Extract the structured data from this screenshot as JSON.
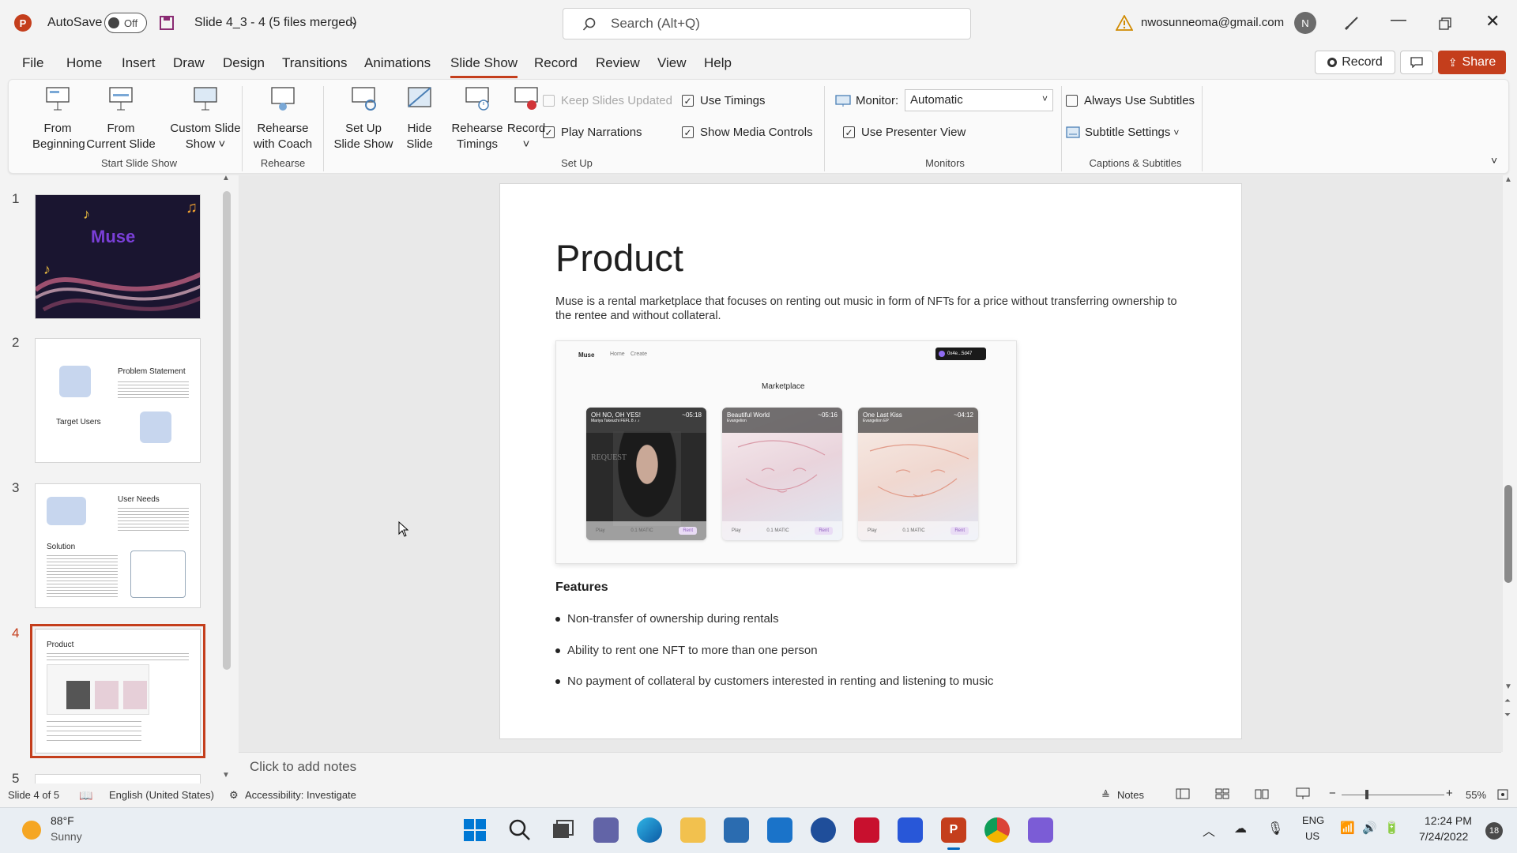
{
  "titlebar": {
    "autosave_label": "AutoSave",
    "autosave_state": "Off",
    "doc_title": "Slide 4_3 - 4 (5 files merged)",
    "search_placeholder": "Search (Alt+Q)",
    "account_email": "nwosunneoma@gmail.com",
    "avatar_initial": "N"
  },
  "menu": {
    "tabs": [
      "File",
      "Home",
      "Insert",
      "Draw",
      "Design",
      "Transitions",
      "Animations",
      "Slide Show",
      "Record",
      "Review",
      "View",
      "Help"
    ],
    "active_tab": "Slide Show",
    "record_button": "Record",
    "share_button": "Share"
  },
  "ribbon": {
    "start": {
      "from_beginning_1": "From",
      "from_beginning_2": "Beginning",
      "from_current_1": "From",
      "from_current_2": "Current Slide",
      "custom_1": "Custom Slide",
      "custom_2": "Show",
      "label": "Start Slide Show"
    },
    "rehearse": {
      "btn_1": "Rehearse",
      "btn_2": "with Coach",
      "label": "Rehearse"
    },
    "setup": {
      "setup_1": "Set Up",
      "setup_2": "Slide Show",
      "hide_1": "Hide",
      "hide_2": "Slide",
      "timings_1": "Rehearse",
      "timings_2": "Timings",
      "record": "Record",
      "keep_updated": "Keep Slides Updated",
      "play_narrations": "Play Narrations",
      "use_timings": "Use Timings",
      "show_media": "Show Media Controls",
      "label": "Set Up"
    },
    "monitors": {
      "monitor_label": "Monitor:",
      "monitor_value": "Automatic",
      "presenter_view": "Use Presenter View",
      "label": "Monitors"
    },
    "captions": {
      "always_subtitles": "Always Use Subtitles",
      "subtitle_settings": "Subtitle Settings",
      "label": "Captions & Subtitles"
    }
  },
  "thumbnails": {
    "numbers": [
      "1",
      "2",
      "3",
      "4",
      "5"
    ],
    "slide1_title": "Muse",
    "slide2_a": "Problem Statement",
    "slide2_b": "Target Users",
    "slide3_a": "User Needs",
    "slide3_b": "Solution",
    "slide4_a": "Product"
  },
  "slide": {
    "title": "Product",
    "description": "Muse is a rental marketplace that focuses on renting out music in form of NFTs for a price without transferring ownership to the rentee and without collateral.",
    "mock": {
      "brand": "Muse",
      "nav_home": "Home",
      "nav_create": "Create",
      "wallet": "0x4e...5d47",
      "heading": "Marketplace",
      "cards": [
        {
          "title": "OH NO, OH YES!",
          "artist": "Mariya Takeuchi FEFL 8 ♪ ♪",
          "time": "~05:18",
          "overlay": "REQUEST"
        },
        {
          "title": "Beautiful World",
          "artist": "Evangelion",
          "time": "~05:16",
          "overlay": ""
        },
        {
          "title": "One Last Kiss",
          "artist": "Evangelion EP",
          "time": "~04:12",
          "overlay": ""
        }
      ],
      "play": "Play",
      "price": "0.1 MATIC",
      "rent": "Rent"
    },
    "features_title": "Features",
    "features": [
      "Non-transfer of ownership during rentals",
      "Ability to rent one NFT to more than one person",
      "No payment of collateral by customers interested in renting and listening to music"
    ]
  },
  "notes_placeholder": "Click to add notes",
  "status": {
    "slide_count": "Slide 4 of 5",
    "language": "English (United States)",
    "accessibility": "Accessibility: Investigate",
    "notes": "Notes",
    "zoom": "55%"
  },
  "taskbar": {
    "temp": "88°F",
    "weather": "Sunny",
    "lang_1": "ENG",
    "lang_2": "US",
    "time": "12:24 PM",
    "date": "7/24/2022",
    "badge": "18"
  },
  "colors": {
    "accent": "#c43e1c",
    "slide_bg": "#ffffff"
  }
}
